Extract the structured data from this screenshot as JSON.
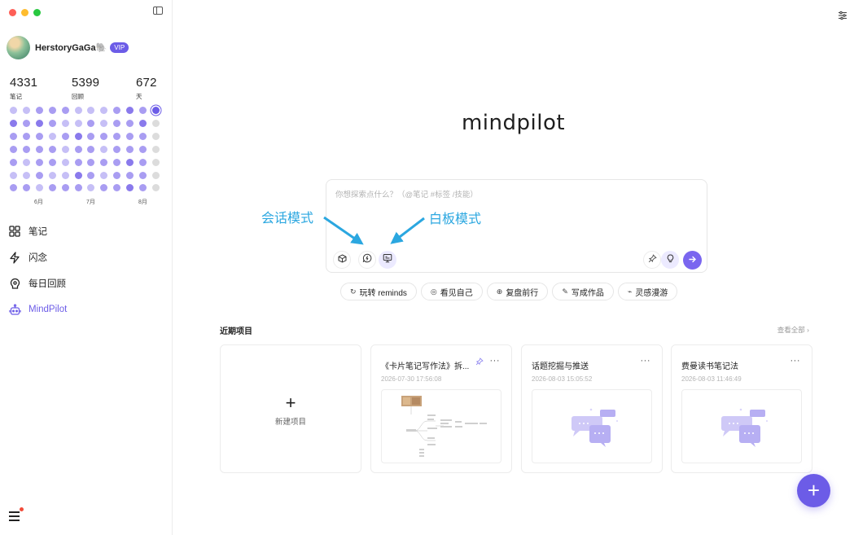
{
  "window": {
    "controls": [
      "close",
      "minimize",
      "zoom"
    ]
  },
  "sidebar": {
    "toggle_icon": "sidebar-toggle-icon",
    "user": {
      "name": "HerstoryGaGa🐘",
      "badge": "VIP"
    },
    "stats": [
      {
        "value": "4331",
        "label": "笔记"
      },
      {
        "value": "5399",
        "label": "回顾"
      },
      {
        "value": "672",
        "label": "天"
      }
    ],
    "heatmap": {
      "levels": [
        [
          1,
          1,
          2,
          2,
          2,
          1,
          1,
          1,
          2,
          3,
          2,
          4
        ],
        [
          3,
          2,
          3,
          2,
          1,
          1,
          2,
          1,
          2,
          2,
          3,
          0
        ],
        [
          2,
          2,
          2,
          1,
          2,
          3,
          2,
          2,
          2,
          2,
          2,
          0
        ],
        [
          2,
          2,
          2,
          2,
          1,
          2,
          2,
          1,
          2,
          2,
          2,
          0
        ],
        [
          2,
          1,
          2,
          2,
          1,
          2,
          2,
          2,
          2,
          3,
          2,
          0
        ],
        [
          1,
          1,
          2,
          1,
          1,
          3,
          2,
          1,
          2,
          2,
          2,
          0
        ],
        [
          2,
          2,
          1,
          2,
          2,
          2,
          1,
          2,
          2,
          3,
          2,
          0
        ]
      ],
      "colors": [
        "#dcdcdc",
        "#c6bff6",
        "#a99df2",
        "#8a7aec",
        "#6c5ce7"
      ],
      "months": [
        "6月",
        "7月",
        "8月"
      ]
    },
    "nav": [
      {
        "label": "笔记",
        "icon": "grid-icon"
      },
      {
        "label": "闪念",
        "icon": "lightning-icon"
      },
      {
        "label": "每日回顾",
        "icon": "brain-icon"
      },
      {
        "label": "MindPilot",
        "icon": "robot-icon",
        "active": true
      }
    ],
    "menu_icon": "hamburger-menu-icon"
  },
  "main": {
    "brand": "mindpilot",
    "composer": {
      "placeholder": "你想探索点什么？（@笔记 #标签 /技能）",
      "left_tools": [
        "cube-icon",
        "chat-mode-icon",
        "whiteboard-mode-icon"
      ],
      "right_tools": [
        "pin-icon",
        "lightbulb-icon"
      ],
      "send_icon": "arrow-right-icon"
    },
    "annotations": {
      "chat_mode": "会话模式",
      "whiteboard_mode": "白板模式"
    },
    "chips": [
      {
        "label": "玩转 reminds",
        "icon": "↻"
      },
      {
        "label": "看见自己",
        "icon": "◎"
      },
      {
        "label": "复盘前行",
        "icon": "⊕"
      },
      {
        "label": "写成作品",
        "icon": "✎"
      },
      {
        "label": "灵感漫游",
        "icon": "⌁"
      }
    ],
    "recent": {
      "title": "近期项目",
      "view_all": "查看全部 ›",
      "new_project": "新建项目",
      "projects": [
        {
          "title": "《卡片笔记写作法》拆...",
          "date": "2026-07-30 17:56:08",
          "pinned": true,
          "thumb": "mindmap"
        },
        {
          "title": "话题挖掘与推送",
          "date": "2026-08-03 15:05:52",
          "pinned": false,
          "thumb": "chat"
        },
        {
          "title": "费曼读书笔记法",
          "date": "2026-08-03 11:46:49",
          "pinned": false,
          "thumb": "chat"
        }
      ],
      "more_label": "···"
    },
    "fab_label": "+"
  },
  "colors": {
    "accent": "#6c5ce7",
    "annotation": "#2ba7e0"
  }
}
